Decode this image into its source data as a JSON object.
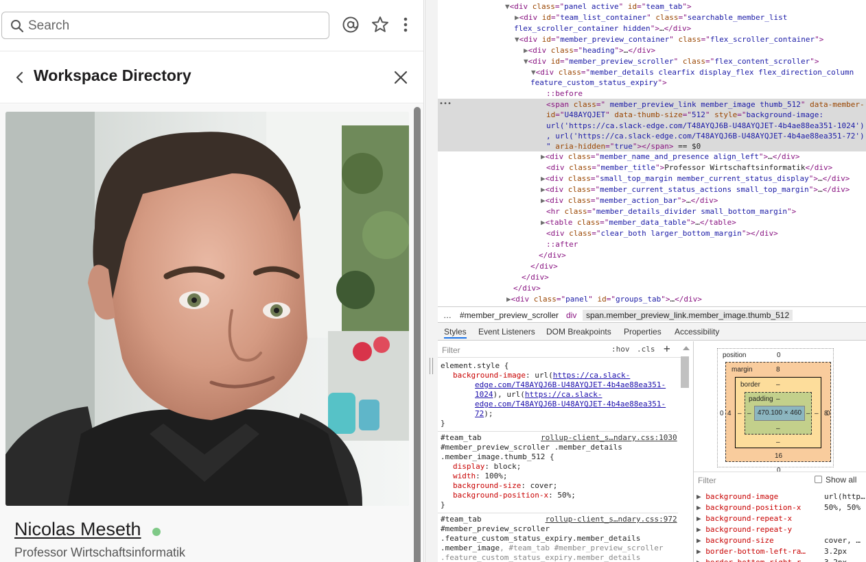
{
  "slack": {
    "search_placeholder": "Search",
    "header_title": "Workspace Directory",
    "member": {
      "name": "Nicolas Meseth",
      "title": "Professor Wirtschaftsinformatik",
      "presence": "active"
    }
  },
  "devtools": {
    "dom_lines": [
      {
        "indent": 0,
        "tri": "▼",
        "html": "<span class=\"tag\">&lt;div</span> <span class=\"attr\">class</span>=\"<span class=\"val\">panel active</span>\" <span class=\"attr\">id</span>=\"<span class=\"val\">team_tab</span>\"<span class=\"tag\">&gt;</span>"
      },
      {
        "indent": 1,
        "tri": "▶",
        "html": "<span class=\"tag\">&lt;div</span> <span class=\"attr\">id</span>=\"<span class=\"val\">team_list_container</span>\" <span class=\"attr\">class</span>=\"<span class=\"val\">searchable_member_list</span>"
      },
      {
        "indent": 1,
        "tri": "",
        "html": "<span class=\"val\">flex_scroller_container hidden</span>\"<span class=\"tag\">&gt;</span><span class=\"txt\">…</span><span class=\"tag\">&lt;/div&gt;</span>",
        "cont": true
      },
      {
        "indent": 1,
        "tri": "▼",
        "html": "<span class=\"tag\">&lt;div</span> <span class=\"attr\">id</span>=\"<span class=\"val\">member_preview_container</span>\" <span class=\"attr\">class</span>=\"<span class=\"val\">flex_scroller_container</span>\"<span class=\"tag\">&gt;</span>"
      },
      {
        "indent": 2,
        "tri": "▶",
        "html": "<span class=\"tag\">&lt;div</span> <span class=\"attr\">class</span>=\"<span class=\"val\">heading</span>\"<span class=\"tag\">&gt;</span><span class=\"txt\">…</span><span class=\"tag\">&lt;/div&gt;</span>"
      },
      {
        "indent": 2,
        "tri": "▼",
        "html": "<span class=\"tag\">&lt;div</span> <span class=\"attr\">id</span>=\"<span class=\"val\">member_preview_scroller</span>\" <span class=\"attr\">class</span>=\"<span class=\"val\">flex_content_scroller</span>\"<span class=\"tag\">&gt;</span>"
      },
      {
        "indent": 3,
        "tri": "▼",
        "html": "<span class=\"tag\">&lt;div</span> <span class=\"attr\">class</span>=\"<span class=\"val\">member_details clearfix display_flex flex_direction_column</span>"
      },
      {
        "indent": 2,
        "tri": "",
        "html": "<span class=\"val\">feature_custom_status_expiry</span>\"<span class=\"tag\">&gt;</span>",
        "cont": true
      },
      {
        "indent": 4,
        "tri": "",
        "html": "<span class=\"pseudo\">::before</span>"
      },
      {
        "indent": 4,
        "tri": "",
        "html": "<span class=\"tag\">&lt;span</span> <span class=\"attr\">class</span>=\"<span class=\"val\"> member_preview_link member_image thumb_512</span>\" <span class=\"attr\">data-member-</span>"
      },
      {
        "indent": 4,
        "tri": "",
        "html": "<span class=\"attr\">id</span>=\"<span class=\"val\">U48AYQJET</span>\" <span class=\"attr\">data-thumb-size</span>=\"<span class=\"val\">512</span>\" <span class=\"attr\">style</span>=\"<span class=\"val\">background-image:</span>"
      },
      {
        "indent": 4,
        "tri": "",
        "html": "<span class=\"val\">url('https://ca.slack-edge.com/T48AYQJ6B-U48AYQJET-4b4ae88ea351-1024')</span>"
      },
      {
        "indent": 4,
        "tri": "",
        "html": "<span class=\"val\">, url('https://ca.slack-edge.com/T48AYQJ6B-U48AYQJET-4b4ae88ea351-72')</span>"
      },
      {
        "indent": 4,
        "tri": "",
        "html": "<span class=\"val\">\"</span> <span class=\"attr\">aria-hidden</span>=\"<span class=\"val\">true</span>\"<span class=\"tag\">&gt;&lt;/span&gt;</span> <span class=\"txt\">== $0</span>"
      },
      {
        "indent": 4,
        "tri": "▶",
        "html": "<span class=\"tag\">&lt;div</span> <span class=\"attr\">class</span>=\"<span class=\"val\">member_name_and_presence align_left</span>\"<span class=\"tag\">&gt;</span><span class=\"txt\">…</span><span class=\"tag\">&lt;/div&gt;</span>"
      },
      {
        "indent": 4,
        "tri": "",
        "html": "<span class=\"tag\">&lt;div</span> <span class=\"attr\">class</span>=\"<span class=\"val\">member_title</span>\"<span class=\"tag\">&gt;</span><span class=\"txt\">Professor Wirtschaftsinformatik</span><span class=\"tag\">&lt;/div&gt;</span>"
      },
      {
        "indent": 4,
        "tri": "▶",
        "html": "<span class=\"tag\">&lt;div</span> <span class=\"attr\">class</span>=\"<span class=\"val\">small_top_margin member_current_status_display</span>\"<span class=\"tag\">&gt;</span><span class=\"txt\">…</span><span class=\"tag\">&lt;/div&gt;</span>"
      },
      {
        "indent": 4,
        "tri": "▶",
        "html": "<span class=\"tag\">&lt;div</span> <span class=\"attr\">class</span>=\"<span class=\"val\">member_current_status_actions small_top_margin</span>\"<span class=\"tag\">&gt;</span><span class=\"txt\">…</span><span class=\"tag\">&lt;/div&gt;</span>"
      },
      {
        "indent": 4,
        "tri": "▶",
        "html": "<span class=\"tag\">&lt;div</span> <span class=\"attr\">class</span>=\"<span class=\"val\">member_action_bar</span>\"<span class=\"tag\">&gt;</span><span class=\"txt\">…</span><span class=\"tag\">&lt;/div&gt;</span>"
      },
      {
        "indent": 4,
        "tri": "",
        "html": "<span class=\"tag\">&lt;hr</span> <span class=\"attr\">class</span>=\"<span class=\"val\">member_details_divider small_bottom_margin</span>\"<span class=\"tag\">&gt;</span>"
      },
      {
        "indent": 4,
        "tri": "▶",
        "html": "<span class=\"tag\">&lt;table</span> <span class=\"attr\">class</span>=\"<span class=\"val\">member_data_table</span>\"<span class=\"tag\">&gt;</span><span class=\"txt\">…</span><span class=\"tag\">&lt;/table&gt;</span>"
      },
      {
        "indent": 4,
        "tri": "",
        "html": "<span class=\"tag\">&lt;div</span> <span class=\"attr\">class</span>=\"<span class=\"val\">clear_both larger_bottom_margin</span>\"<span class=\"tag\">&gt;&lt;/div&gt;</span>"
      },
      {
        "indent": 4,
        "tri": "",
        "html": "<span class=\"pseudo\">::after</span>"
      },
      {
        "indent": 3,
        "tri": "",
        "html": "<span class=\"tag\">&lt;/div&gt;</span>"
      },
      {
        "indent": 2,
        "tri": "",
        "html": "<span class=\"tag\">&lt;/div&gt;</span>"
      },
      {
        "indent": 1,
        "tri": "",
        "html": "<span class=\"tag\">&lt;/div&gt;</span>"
      },
      {
        "indent": 0,
        "tri": "",
        "html": "<span class=\"tag\">&lt;/div&gt;</span>"
      },
      {
        "indent": 0,
        "tri": "▶",
        "html": "<span class=\"tag\">&lt;div</span> <span class=\"attr\">class</span>=\"<span class=\"val\">panel</span>\" <span class=\"attr\">id</span>=\"<span class=\"val\">groups_tab</span>\"<span class=\"tag\">&gt;</span><span class=\"txt\">…</span><span class=\"tag\">&lt;/div&gt;</span>"
      }
    ],
    "breadcrumbs": [
      "…",
      "#member_preview_scroller",
      "div",
      "span.member_preview_link.member_image.thumb_512"
    ],
    "tabs": [
      "Styles",
      "Event Listeners",
      "DOM Breakpoints",
      "Properties",
      "Accessibility"
    ],
    "filter_placeholder": "Filter",
    "hov_label": ":hov",
    "cls_label": ".cls",
    "add_label": "+",
    "style_lines": [
      {
        "kind": "plain",
        "text": "element.style {"
      },
      {
        "kind": "decl",
        "prop": "background-image",
        "val": "url(",
        "link": "https://ca.slack-",
        "after": ""
      },
      {
        "kind": "linkonly",
        "text": "edge.com/T48AYQJ6B-U48AYQJET-4b4ae88ea351-"
      },
      {
        "kind": "linkmix",
        "link": "1024",
        "after": "), url(",
        "link2": "https://ca.slack-"
      },
      {
        "kind": "linkonly",
        "text": "edge.com/T48AYQJ6B-U48AYQJET-4b4ae88ea351-"
      },
      {
        "kind": "linkend",
        "link": "72",
        "after": ");"
      },
      {
        "kind": "plain",
        "text": "}"
      },
      {
        "kind": "sep"
      },
      {
        "kind": "selector",
        "text": "#team_tab",
        "src": "rollup-client_s…ndary.css:1030"
      },
      {
        "kind": "plain",
        "text": "#member_preview_scroller .member_details"
      },
      {
        "kind": "plain",
        "text": ".member_image.thumb_512 {"
      },
      {
        "kind": "decl2",
        "prop": "display",
        "val": "block;"
      },
      {
        "kind": "decl2",
        "prop": "width",
        "val": "100%;"
      },
      {
        "kind": "decl2",
        "prop": "background-size",
        "val": "cover;"
      },
      {
        "kind": "decl2",
        "prop": "background-position-x",
        "val": "50%;"
      },
      {
        "kind": "plain",
        "text": "}"
      },
      {
        "kind": "sep"
      },
      {
        "kind": "selector",
        "text": "#team_tab",
        "src": "rollup-client_s…ndary.css:972"
      },
      {
        "kind": "plain",
        "text": "#member_preview_scroller"
      },
      {
        "kind": "plain",
        "text": ".feature_custom_status_expiry.member_details"
      },
      {
        "kind": "mix",
        "a": ".member_image",
        "b": ", #team_tab #member_preview_scroller"
      },
      {
        "kind": "grey",
        "text": ".feature_custom_status_expiry.member_details"
      }
    ],
    "box_model": {
      "position_label": "position",
      "position_val": "0",
      "margin_label": "margin",
      "margin_top": "8",
      "margin_bottom": "16",
      "margin_left": "4",
      "margin_right": "8",
      "border_label": "border",
      "border_top": "–",
      "border_bottom": "–",
      "border_left": "–",
      "border_right": "–",
      "padding_label": "padding",
      "padding_top": "–",
      "padding_bottom": "–",
      "padding_left": "–",
      "padding_right": "–",
      "content": "470.100 × 460",
      "position_left": "0",
      "position_right": "0",
      "position_bottom": "0"
    },
    "computed_filter_placeholder": "Filter",
    "show_all": "Show all",
    "computed": [
      {
        "prop": "background-image",
        "val": "url(http…"
      },
      {
        "prop": "background-position-x",
        "val": "50%, 50%"
      },
      {
        "prop": "background-repeat-x",
        "val": ""
      },
      {
        "prop": "background-repeat-y",
        "val": ""
      },
      {
        "prop": "background-size",
        "val": "cover, …"
      },
      {
        "prop": "border-bottom-left-ra…",
        "val": "3.2px"
      },
      {
        "prop": "border-bottom-right-r…",
        "val": "3.2px"
      }
    ]
  }
}
